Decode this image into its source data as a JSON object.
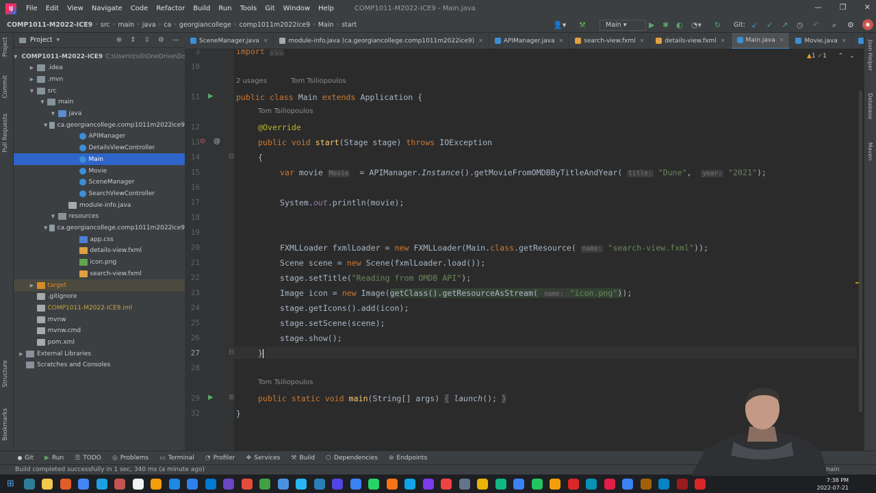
{
  "window": {
    "title": "COMP1011-M2022-ICE9 - Main.java"
  },
  "menu": [
    "File",
    "Edit",
    "View",
    "Navigate",
    "Code",
    "Refactor",
    "Build",
    "Run",
    "Tools",
    "Git",
    "Window",
    "Help"
  ],
  "breadcrumbs": [
    "COMP1011-M2022-ICE9",
    "src",
    "main",
    "java",
    "ca",
    "georgiancollege",
    "comp1011m2022ice9",
    "Main",
    "start"
  ],
  "toolbar": {
    "run_config": "Main",
    "git_label": "Git:"
  },
  "project_panel": {
    "title": "Project",
    "tree": [
      {
        "label": "COMP1011-M2022-ICE9",
        "extra": "C:\\Users\\tsili\\OneDrive\\Do",
        "indent": 0,
        "arrow": "down",
        "icon": "folderb",
        "bold": true
      },
      {
        "label": ".idea",
        "indent": 1,
        "arrow": "right",
        "icon": "folder"
      },
      {
        "label": ".mvn",
        "indent": 1,
        "arrow": "right",
        "icon": "folder"
      },
      {
        "label": "src",
        "indent": 1,
        "arrow": "down",
        "icon": "folder"
      },
      {
        "label": "main",
        "indent": 2,
        "arrow": "down",
        "icon": "folder"
      },
      {
        "label": "java",
        "indent": 3,
        "arrow": "down",
        "icon": "folderb"
      },
      {
        "label": "ca.georgiancollege.comp1011m2022ice9",
        "indent": 4,
        "arrow": "down",
        "icon": "pkg"
      },
      {
        "label": "APIManager",
        "indent": 5,
        "arrow": "",
        "icon": "cls"
      },
      {
        "label": "DetailsViewController",
        "indent": 5,
        "arrow": "",
        "icon": "cls"
      },
      {
        "label": "Main",
        "indent": 5,
        "arrow": "",
        "icon": "cls",
        "selected": true
      },
      {
        "label": "Movie",
        "indent": 5,
        "arrow": "",
        "icon": "cls"
      },
      {
        "label": "SceneManager",
        "indent": 5,
        "arrow": "",
        "icon": "cls"
      },
      {
        "label": "SearchViewController",
        "indent": 5,
        "arrow": "",
        "icon": "cls"
      },
      {
        "label": "module-info.java",
        "indent": 4,
        "arrow": "",
        "icon": "file"
      },
      {
        "label": "resources",
        "indent": 3,
        "arrow": "down",
        "icon": "folder"
      },
      {
        "label": "ca.georgiancollege.comp1011m2022ice9",
        "indent": 4,
        "arrow": "down",
        "icon": "pkg"
      },
      {
        "label": "app.css",
        "indent": 5,
        "arrow": "",
        "icon": "css"
      },
      {
        "label": "details-view.fxml",
        "indent": 5,
        "arrow": "",
        "icon": "xml"
      },
      {
        "label": "icon.png",
        "indent": 5,
        "arrow": "",
        "icon": "png"
      },
      {
        "label": "search-view.fxml",
        "indent": 5,
        "arrow": "",
        "icon": "xml"
      },
      {
        "label": "target",
        "indent": 1,
        "arrow": "right",
        "icon": "folderr",
        "target": true
      },
      {
        "label": ".gitignore",
        "indent": 1,
        "arrow": "",
        "icon": "file"
      },
      {
        "label": "COMP1011-M2022-ICE9.iml",
        "indent": 1,
        "arrow": "",
        "icon": "file",
        "yellow": true
      },
      {
        "label": "mvnw",
        "indent": 1,
        "arrow": "",
        "icon": "file"
      },
      {
        "label": "mvnw.cmd",
        "indent": 1,
        "arrow": "",
        "icon": "file"
      },
      {
        "label": "pom.xml",
        "indent": 1,
        "arrow": "",
        "icon": "file"
      },
      {
        "label": "External Libraries",
        "indent": 0,
        "arrow": "right",
        "icon": "lib"
      },
      {
        "label": "Scratches and Consoles",
        "indent": 0,
        "arrow": "",
        "icon": "lib"
      }
    ]
  },
  "editor_tabs": [
    {
      "label": "SceneManager.java",
      "icon": "cls"
    },
    {
      "label": "module-info.java (ca.georgiancollege.comp1011m2022ice9)",
      "icon": "file"
    },
    {
      "label": "APIManager.java",
      "icon": "cls"
    },
    {
      "label": "search-view.fxml",
      "icon": "xml"
    },
    {
      "label": "details-view.fxml",
      "icon": "xml"
    },
    {
      "label": "Main.java",
      "icon": "cls",
      "active": true
    },
    {
      "label": "Movie.java",
      "icon": "cls"
    },
    {
      "label": "DetailsViewC",
      "icon": "cls"
    }
  ],
  "editor": {
    "inspection": "▲1 ✓1",
    "usages": "2 usages",
    "author": "Tom Tsiliopoulos",
    "line_numbers": [
      "3",
      "10",
      "11",
      "12",
      "13",
      "14",
      "15",
      "16",
      "17",
      "18",
      "19",
      "20",
      "21",
      "22",
      "23",
      "24",
      "25",
      "26",
      "27",
      "28",
      "29",
      "32"
    ],
    "hints": {
      "movie_type": "Movie",
      "title_param": "title:",
      "year_param": "year:",
      "name_param": "name:"
    },
    "strings": {
      "dune": "\"Dune\"",
      "year": "\"2021\"",
      "search_view": "\"search-view.fxml\"",
      "window_title": "\"Reading from OMDB API\"",
      "icon_png": "\"icon.png\""
    }
  },
  "bottom_tabs": [
    "Git",
    "Run",
    "TODO",
    "Problems",
    "Terminal",
    "Profiler",
    "Services",
    "Build",
    "Dependencies",
    "Endpoints"
  ],
  "status": {
    "message": "Build completed successfully in 1 sec, 340 ms (a minute ago)"
  },
  "taskbar": {
    "time": "7:38 PM",
    "date": "2022-07-21"
  },
  "right_strip": [
    "Json Helper",
    "Database",
    "Maven"
  ],
  "left_strip": [
    "Project",
    "Commit",
    "Pull Requests",
    "Structure",
    "Bookmarks"
  ]
}
